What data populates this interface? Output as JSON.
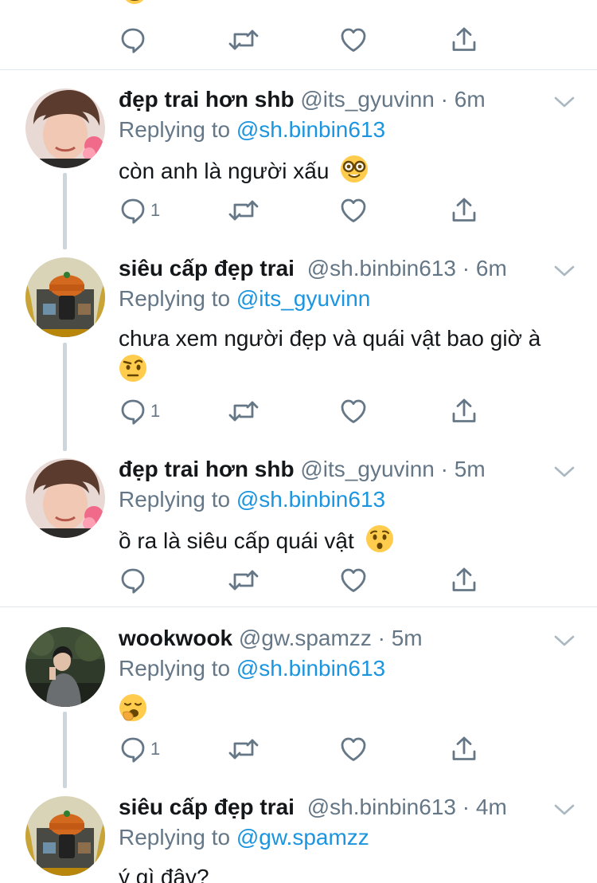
{
  "tweets": [
    {
      "name": "đẹp trai hơn shb",
      "handle": "@its_gyuvinn",
      "dot": "·",
      "time": "6m",
      "replying_label": "Replying to",
      "replying_to": "@sh.binbin613",
      "text": "còn anh là người xấu",
      "emoji": "nerd-face",
      "reply_count": "1"
    },
    {
      "name": "siêu cấp đẹp trai",
      "handle": "@sh.binbin613",
      "dot": "·",
      "time": "6m",
      "replying_label": "Replying to",
      "replying_to": "@its_gyuvinn",
      "text_line1": "chưa xem người đẹp và quái vật bao giờ à",
      "emoji": "raised-eyebrow-face",
      "reply_count": "1"
    },
    {
      "name": "đẹp trai hơn shb",
      "handle": "@its_gyuvinn",
      "dot": "·",
      "time": "5m",
      "replying_label": "Replying to",
      "replying_to": "@sh.binbin613",
      "text": "ồ ra là siêu cấp quái vật",
      "emoji": "hushed-face"
    },
    {
      "name": "wookwook",
      "handle": "@gw.spamzz",
      "dot": "·",
      "time": "5m",
      "replying_label": "Replying to",
      "replying_to": "@sh.binbin613",
      "emoji": "yawning-face",
      "reply_count": "1"
    },
    {
      "name": "siêu cấp đẹp trai",
      "handle": "@sh.binbin613",
      "dot": "·",
      "time": "4m",
      "replying_label": "Replying to",
      "replying_to": "@gw.spamzz",
      "text": "ý gì đây?"
    }
  ],
  "colors": {
    "link": "#1b95e0",
    "secondary": "#657786",
    "divider": "#e1e8ed",
    "thread_line": "#ccd6dd"
  }
}
